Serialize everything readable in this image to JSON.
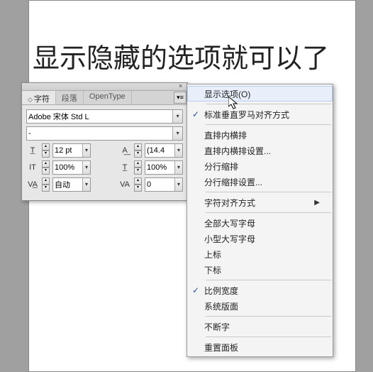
{
  "canvas_text": "显示隐藏的选项就可以了",
  "panel": {
    "tabs": {
      "char": "字符",
      "para": "段落",
      "ot": "OpenType"
    },
    "font_family": "Adobe 宋体 Std L",
    "font_style": "-",
    "size": "12 pt",
    "leading": "(14.4",
    "hscale": "100%",
    "vscale": "100%",
    "kerning": "自动",
    "tracking": "0"
  },
  "menu": {
    "show_options": "显示选项(O)",
    "standard_align": "标准垂直罗马对齐方式",
    "tatechuyoko": "直排内横排",
    "tatechuyoko_set": "直排内横排设置...",
    "warichu": "分行缩排",
    "warichu_set": "分行缩排设置...",
    "char_align": "字符对齐方式",
    "all_caps": "全部大写字母",
    "small_caps": "小型大写字母",
    "superscript": "上标",
    "subscript": "下标",
    "proportional": "比例宽度",
    "system_layout": "系统版面",
    "no_break": "不断字",
    "reset_panel": "重置面板"
  }
}
